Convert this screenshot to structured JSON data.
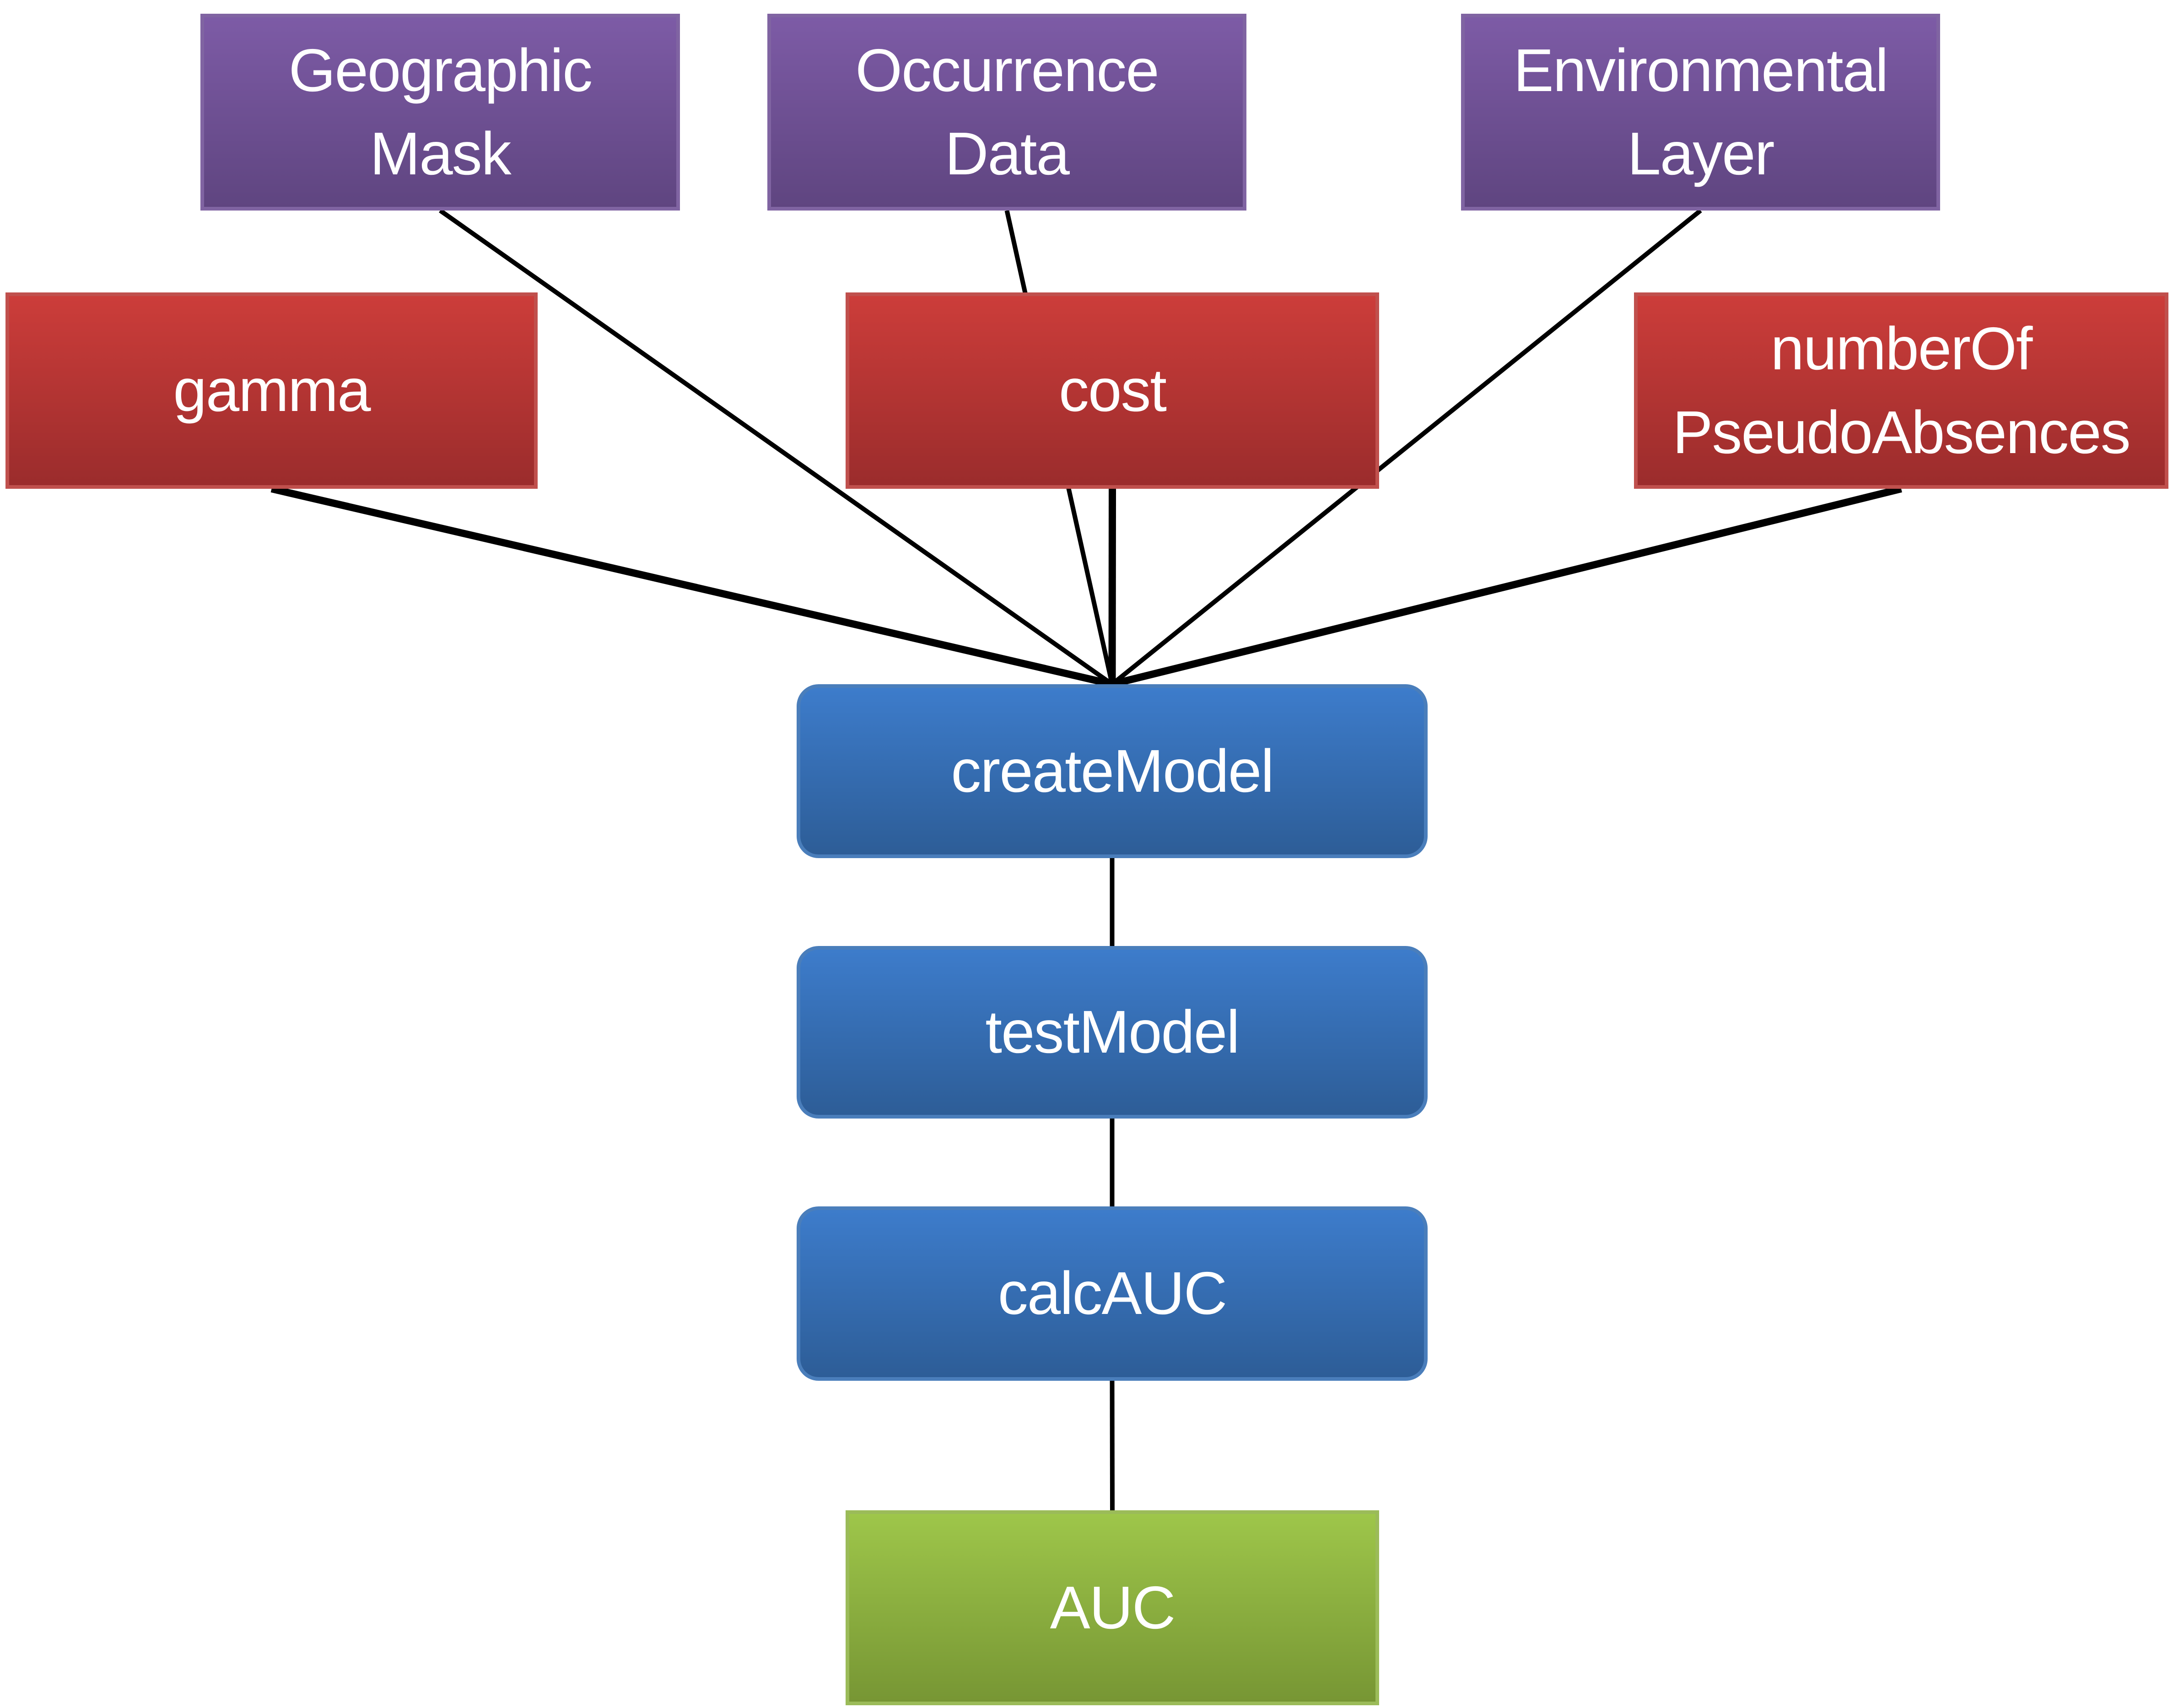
{
  "diagram": {
    "type": "flowchart",
    "inputs": [
      {
        "id": "geographic-mask",
        "label": "Geographic\nMask"
      },
      {
        "id": "occurrence-data",
        "label": "Occurrence\nData"
      },
      {
        "id": "environmental-layer",
        "label": "Environmental\nLayer"
      }
    ],
    "parameters": [
      {
        "id": "gamma",
        "label": "gamma"
      },
      {
        "id": "cost",
        "label": "cost"
      },
      {
        "id": "number-of-pseudo-absences",
        "label": "numberOf\nPseudoAbsences"
      }
    ],
    "processes": [
      {
        "id": "create-model",
        "label": "createModel"
      },
      {
        "id": "test-model",
        "label": "testModel"
      },
      {
        "id": "calc-auc",
        "label": "calcAUC"
      }
    ],
    "output": {
      "id": "auc",
      "label": "AUC"
    },
    "edges": [
      {
        "from": "geographic-mask",
        "to": "create-model"
      },
      {
        "from": "occurrence-data",
        "to": "create-model"
      },
      {
        "from": "environmental-layer",
        "to": "create-model"
      },
      {
        "from": "gamma",
        "to": "create-model"
      },
      {
        "from": "cost",
        "to": "create-model"
      },
      {
        "from": "number-of-pseudo-absences",
        "to": "create-model"
      },
      {
        "from": "create-model",
        "to": "test-model"
      },
      {
        "from": "test-model",
        "to": "calc-auc"
      },
      {
        "from": "calc-auc",
        "to": "auc"
      }
    ],
    "colors": {
      "input": "#8064a2",
      "parameter": "#c0504d",
      "process": "#4a7ebb",
      "output": "#9bbb59",
      "edge": "#000000",
      "text": "#ffffff"
    }
  }
}
